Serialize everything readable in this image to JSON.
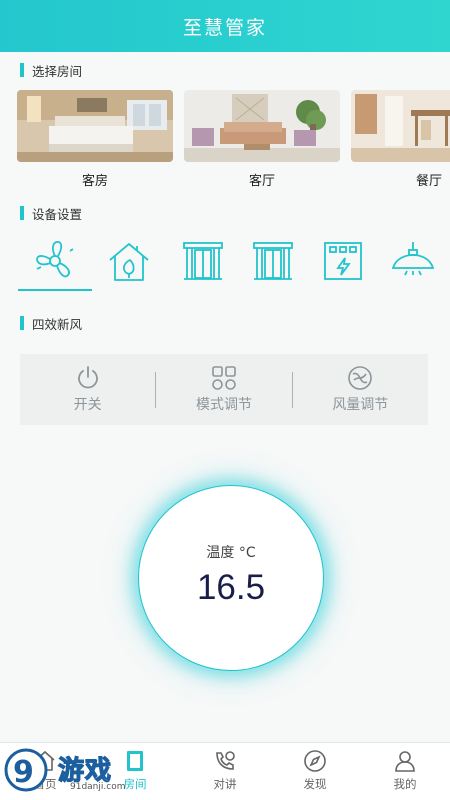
{
  "header": {
    "title": "至慧管家"
  },
  "sections": {
    "rooms_title": "选择房间",
    "devices_title": "设备设置",
    "fresh_air_title": "四效新风"
  },
  "rooms": [
    {
      "name": "客房",
      "selected": false
    },
    {
      "name": "客厅",
      "selected": true
    },
    {
      "name": "餐厅",
      "selected": false
    }
  ],
  "devices": [
    {
      "icon": "fan-icon",
      "selected": true
    },
    {
      "icon": "house-leaf-icon",
      "selected": false
    },
    {
      "icon": "curtain-icon",
      "selected": false
    },
    {
      "icon": "curtain-icon",
      "selected": false
    },
    {
      "icon": "power-panel-icon",
      "selected": false
    },
    {
      "icon": "ceiling-lamp-icon",
      "selected": false
    }
  ],
  "panel": {
    "power": "开关",
    "mode": "模式调节",
    "wind": "风量调节"
  },
  "dial": {
    "label": "温度 °C",
    "value": "16.5"
  },
  "tabs": [
    {
      "label": "首页",
      "icon": "home-icon"
    },
    {
      "label": "房间",
      "icon": "room-icon",
      "active": true
    },
    {
      "label": "对讲",
      "icon": "intercom-icon"
    },
    {
      "label": "发现",
      "icon": "compass-icon"
    },
    {
      "label": "我的",
      "icon": "user-icon"
    }
  ],
  "watermark": {
    "text": "游戏",
    "number": "9",
    "url": "91danji.com"
  },
  "colors": {
    "accent": "#22c4cc",
    "header": "#2bd0ce",
    "text": "#333333",
    "muted": "#8c959a"
  }
}
